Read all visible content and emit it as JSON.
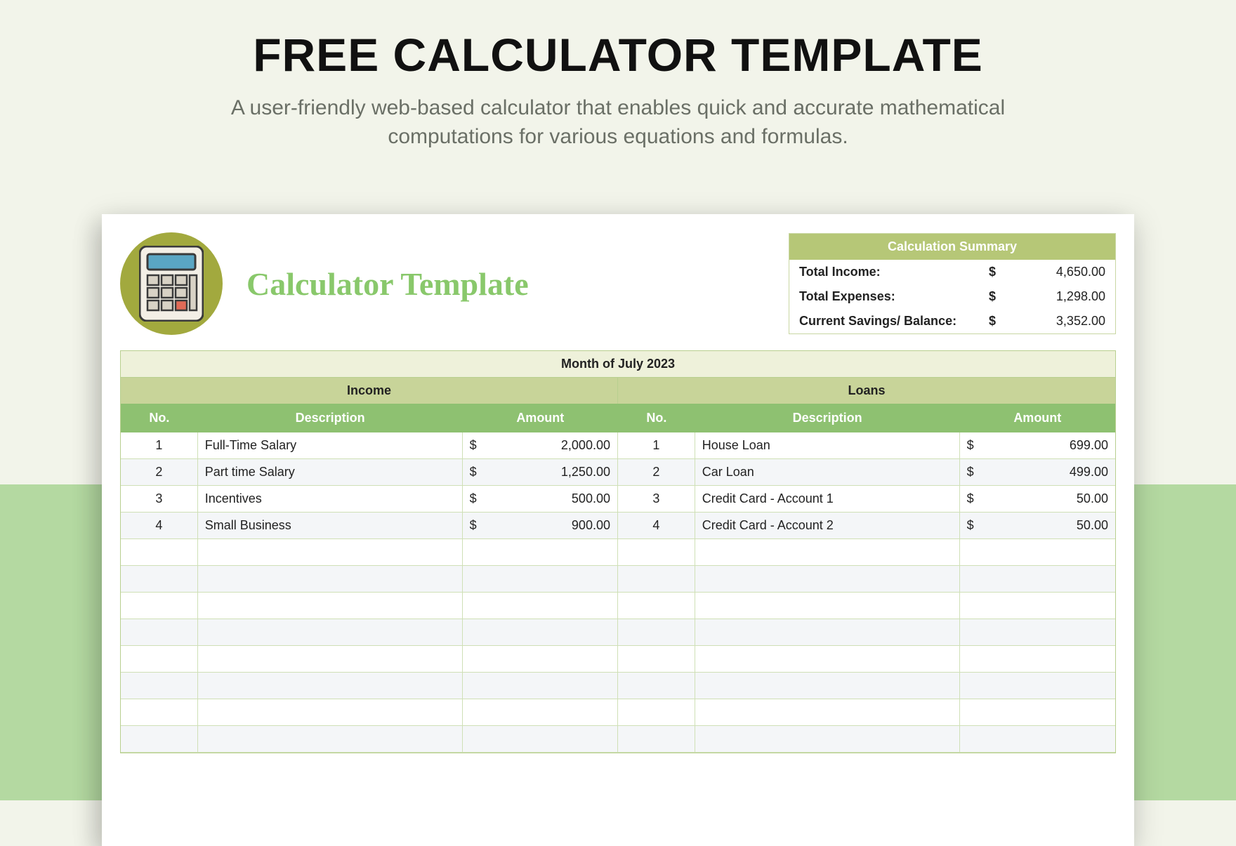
{
  "page": {
    "title": "FREE CALCULATOR TEMPLATE",
    "subtitle": "A user-friendly web-based calculator that enables quick and accurate mathematical computations for various equations and formulas."
  },
  "sheet": {
    "title": "Calculator Template",
    "summary": {
      "heading": "Calculation Summary",
      "rows": [
        {
          "label": "Total Income:",
          "currency": "$",
          "value": "4,650.00"
        },
        {
          "label": "Total Expenses:",
          "currency": "$",
          "value": "1,298.00"
        },
        {
          "label": "Current Savings/ Balance:",
          "currency": "$",
          "value": "3,352.00"
        }
      ]
    },
    "month": "Month of July 2023",
    "sections": {
      "left": "Income",
      "right": "Loans"
    },
    "columns": {
      "no": "No.",
      "desc": "Description",
      "amt": "Amount"
    },
    "rows": [
      {
        "l_no": "1",
        "l_desc": "Full-Time Salary",
        "l_cur": "$",
        "l_amt": "2,000.00",
        "r_no": "1",
        "r_desc": "House Loan",
        "r_cur": "$",
        "r_amt": "699.00"
      },
      {
        "l_no": "2",
        "l_desc": "Part time Salary",
        "l_cur": "$",
        "l_amt": "1,250.00",
        "r_no": "2",
        "r_desc": "Car Loan",
        "r_cur": "$",
        "r_amt": "499.00"
      },
      {
        "l_no": "3",
        "l_desc": "Incentives",
        "l_cur": "$",
        "l_amt": "500.00",
        "r_no": "3",
        "r_desc": "Credit Card - Account 1",
        "r_cur": "$",
        "r_amt": "50.00"
      },
      {
        "l_no": "4",
        "l_desc": "Small Business",
        "l_cur": "$",
        "l_amt": "900.00",
        "r_no": "4",
        "r_desc": "Credit Card - Account 2",
        "r_cur": "$",
        "r_amt": "50.00"
      },
      {
        "l_no": "",
        "l_desc": "",
        "l_cur": "",
        "l_amt": "",
        "r_no": "",
        "r_desc": "",
        "r_cur": "",
        "r_amt": ""
      },
      {
        "l_no": "",
        "l_desc": "",
        "l_cur": "",
        "l_amt": "",
        "r_no": "",
        "r_desc": "",
        "r_cur": "",
        "r_amt": ""
      },
      {
        "l_no": "",
        "l_desc": "",
        "l_cur": "",
        "l_amt": "",
        "r_no": "",
        "r_desc": "",
        "r_cur": "",
        "r_amt": ""
      },
      {
        "l_no": "",
        "l_desc": "",
        "l_cur": "",
        "l_amt": "",
        "r_no": "",
        "r_desc": "",
        "r_cur": "",
        "r_amt": ""
      },
      {
        "l_no": "",
        "l_desc": "",
        "l_cur": "",
        "l_amt": "",
        "r_no": "",
        "r_desc": "",
        "r_cur": "",
        "r_amt": ""
      },
      {
        "l_no": "",
        "l_desc": "",
        "l_cur": "",
        "l_amt": "",
        "r_no": "",
        "r_desc": "",
        "r_cur": "",
        "r_amt": ""
      },
      {
        "l_no": "",
        "l_desc": "",
        "l_cur": "",
        "l_amt": "",
        "r_no": "",
        "r_desc": "",
        "r_cur": "",
        "r_amt": ""
      },
      {
        "l_no": "",
        "l_desc": "",
        "l_cur": "",
        "l_amt": "",
        "r_no": "",
        "r_desc": "",
        "r_cur": "",
        "r_amt": ""
      }
    ]
  }
}
